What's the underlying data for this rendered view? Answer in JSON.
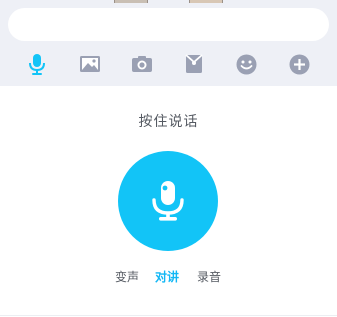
{
  "input": {
    "value": "",
    "placeholder": ""
  },
  "toolbar": {
    "items": [
      {
        "name": "voice",
        "icon": "microphone-icon",
        "active": true
      },
      {
        "name": "image",
        "icon": "image-icon",
        "active": false
      },
      {
        "name": "camera",
        "icon": "camera-icon",
        "active": false
      },
      {
        "name": "red-packet",
        "icon": "red-packet-icon",
        "active": false
      },
      {
        "name": "emoji",
        "icon": "emoji-icon",
        "active": false
      },
      {
        "name": "more",
        "icon": "plus-circle-icon",
        "active": false
      }
    ]
  },
  "voice_panel": {
    "hint": "按住说话",
    "modes": [
      {
        "label": "变声",
        "active": false
      },
      {
        "label": "对讲",
        "active": true
      },
      {
        "label": "录音",
        "active": false
      }
    ]
  },
  "colors": {
    "accent": "#12c4f7",
    "icon_gray": "#9aa0b3",
    "toolbar_bg": "#eef0f6"
  }
}
